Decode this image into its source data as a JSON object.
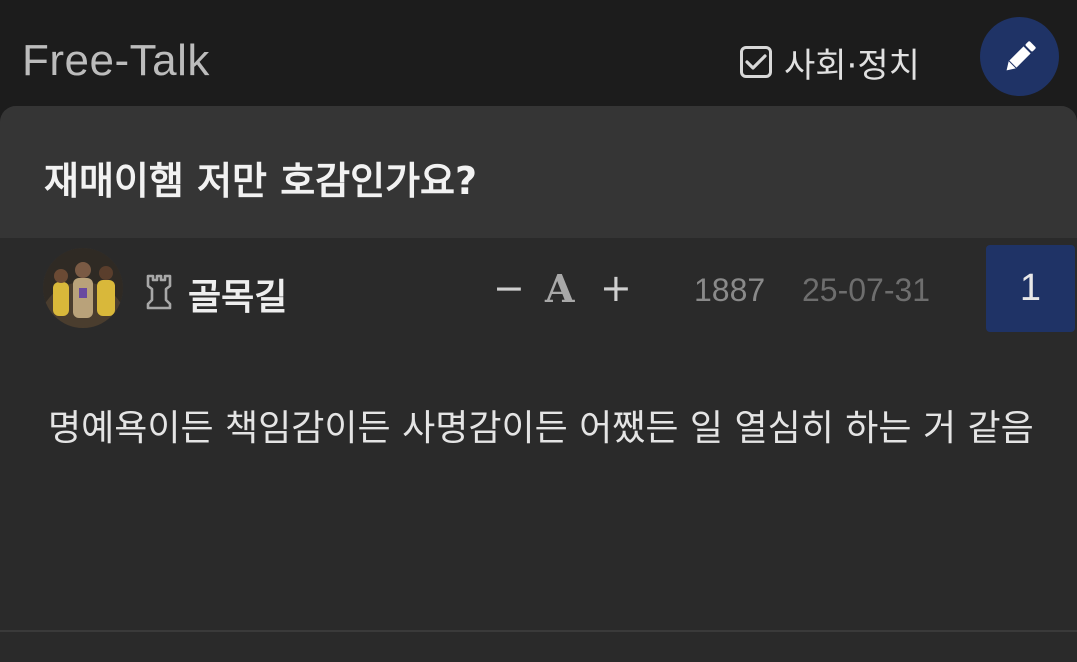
{
  "header": {
    "board_title": "Free-Talk",
    "category_label": "사회·정치",
    "category_checked": true,
    "write_icon": "pencil-icon"
  },
  "post": {
    "title": "재매이햄 저만 호감인가요?",
    "author": "골목길",
    "level_icon": "rook-icon",
    "font_controls": {
      "minus": "−",
      "font": "A",
      "plus": "+"
    },
    "views": "1887",
    "date": "25-07-31",
    "comment_count": "1",
    "body": "명예욕이든 책임감이든 사명감이든 어쨌든 일 열심히 하는 거 같음"
  },
  "colors": {
    "background": "#1c1c1c",
    "card": "#2a2a2a",
    "title_bar": "#353535",
    "accent": "#1f3366"
  }
}
